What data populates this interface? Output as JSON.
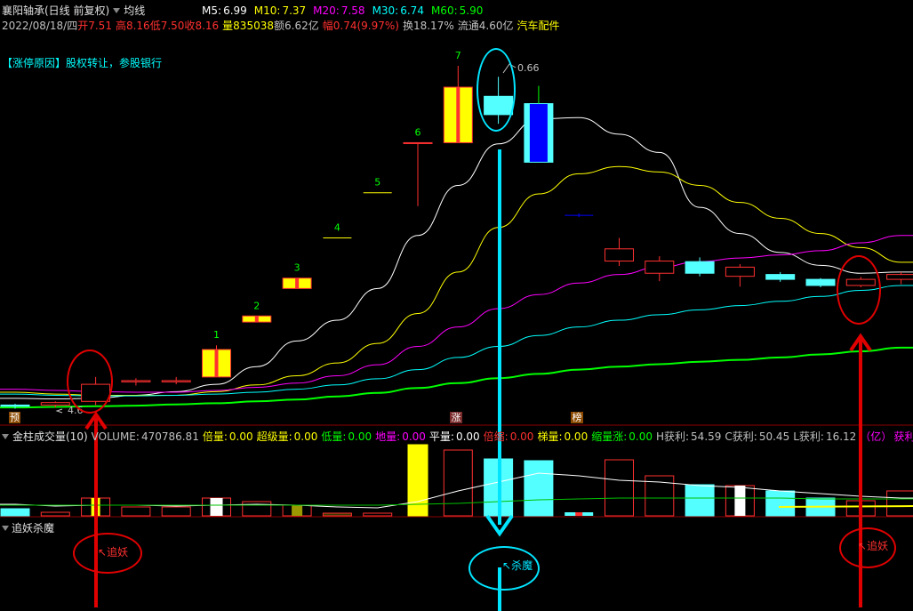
{
  "header": {
    "stock_title": "襄阳轴承(日线 前复权)",
    "indicator_name": "均线",
    "ma": [
      {
        "label": "M5:",
        "value": "6.99",
        "color": "#ffffff"
      },
      {
        "label": "M10:",
        "value": "7.37",
        "color": "#ffff00"
      },
      {
        "label": "M20:",
        "value": "7.58",
        "color": "#ff00ff"
      },
      {
        "label": "M30:",
        "value": "6.74",
        "color": "#00ffff"
      },
      {
        "label": "M60:",
        "value": "5.90",
        "color": "#00ff00"
      }
    ],
    "quote": {
      "date": "2022/08/18/四",
      "open_label": "开",
      "open": "7.51",
      "high_label": "高",
      "high": "8.16",
      "low_label": "低",
      "low": "7.50",
      "close_label": "收",
      "close": "8.16",
      "vol_label": "量",
      "vol": "835038",
      "amount_label": "额",
      "amount": "6.62亿",
      "change_label": "幅",
      "change": "0.74(9.97%)",
      "turnover_label": "换",
      "turnover": "18.17%",
      "float_label": "流通",
      "float": "4.60亿",
      "sector": "汽车配件"
    }
  },
  "reason_text": "【涨停原因】股权转让，参股银行",
  "badges": {
    "yu": "预",
    "zhang": "涨",
    "bang": "榜"
  },
  "price_labels": {
    "low_label": "4.6",
    "high_label": "0.66"
  },
  "count_labels": [
    "1",
    "2",
    "3",
    "4",
    "5",
    "6",
    "7"
  ],
  "volume_panel": {
    "name": "金柱成交量(10)",
    "items": [
      {
        "label": "VOLUME:",
        "value": "470786.81",
        "color": "#c0c0c0"
      },
      {
        "label": "倍量:",
        "value": "0.00",
        "color": "#ffff00"
      },
      {
        "label": "超级量:",
        "value": "0.00",
        "color": "#ffff00"
      },
      {
        "label": "低量:",
        "value": "0.00",
        "color": "#00ff00"
      },
      {
        "label": "地量:",
        "value": "0.00",
        "color": "#ff00ff"
      },
      {
        "label": "平量:",
        "value": "0.00",
        "color": "#ffffff"
      },
      {
        "label": "倍缩:",
        "value": "0.00",
        "color": "#ff3030"
      },
      {
        "label": "梯量:",
        "value": "0.00",
        "color": "#ffff00"
      },
      {
        "label": "缩量涨:",
        "value": "0.00",
        "color": "#00ff00"
      },
      {
        "label": "H获利:",
        "value": "54.59",
        "color": "#c0c0c0"
      },
      {
        "label": "C获利:",
        "value": "50.45",
        "color": "#c0c0c0"
      },
      {
        "label": "L获利:",
        "value": "16.12",
        "color": "#c0c0c0"
      },
      {
        "label": "（亿）",
        "value": "获利筹",
        "color": "#ff00ff"
      }
    ]
  },
  "signal_panel": {
    "name": "追妖杀魔",
    "buy_label": "追妖",
    "kill_label": "杀魔"
  },
  "chart_data": {
    "type": "candlestick",
    "candles": [
      {
        "o": 4.62,
        "h": 4.66,
        "l": 4.58,
        "c": 4.64,
        "color": "cyan"
      },
      {
        "o": 4.64,
        "h": 4.7,
        "l": 4.6,
        "c": 4.68,
        "color": "red"
      },
      {
        "o": 4.7,
        "h": 5.1,
        "l": 4.64,
        "c": 4.98,
        "color": "red"
      },
      {
        "o": 5.02,
        "h": 5.08,
        "l": 4.96,
        "c": 5.04,
        "color": "red"
      },
      {
        "o": 5.02,
        "h": 5.1,
        "l": 4.98,
        "c": 5.04,
        "color": "red"
      },
      {
        "o": 5.1,
        "h": 5.62,
        "l": 5.1,
        "c": 5.55,
        "color": "limit",
        "label": "1"
      },
      {
        "o": 6.0,
        "h": 6.1,
        "l": 6.0,
        "c": 6.1,
        "color": "limit",
        "label": "2"
      },
      {
        "o": 6.55,
        "h": 6.72,
        "l": 6.55,
        "c": 6.72,
        "color": "limit",
        "label": "3"
      },
      {
        "o": 7.38,
        "h": 7.38,
        "l": 7.38,
        "c": 7.38,
        "color": "flat",
        "label": "4"
      },
      {
        "o": 8.12,
        "h": 8.12,
        "l": 8.12,
        "c": 8.12,
        "color": "flat",
        "label": "5"
      },
      {
        "o": 8.94,
        "h": 8.94,
        "l": 7.9,
        "c": 8.94,
        "color": "red",
        "label": "6"
      },
      {
        "o": 8.94,
        "h": 10.2,
        "l": 8.94,
        "c": 9.85,
        "color": "limit",
        "label": "7"
      },
      {
        "o": 9.7,
        "h": 10.02,
        "l": 9.25,
        "c": 9.4,
        "color": "cyan"
      },
      {
        "o": 9.58,
        "h": 9.58,
        "l": 8.62,
        "c": 8.62,
        "color": "blue"
      },
      {
        "o": 7.75,
        "h": 7.78,
        "l": 7.72,
        "c": 7.75,
        "color": "blueflat"
      },
      {
        "o": 7.0,
        "h": 7.38,
        "l": 6.92,
        "c": 7.2,
        "color": "red"
      },
      {
        "o": 6.8,
        "h": 7.08,
        "l": 6.67,
        "c": 7.0,
        "color": "red"
      },
      {
        "o": 6.99,
        "h": 7.06,
        "l": 6.75,
        "c": 6.8,
        "color": "cyan"
      },
      {
        "o": 6.75,
        "h": 6.95,
        "l": 6.58,
        "c": 6.9,
        "color": "red"
      },
      {
        "o": 6.78,
        "h": 6.82,
        "l": 6.66,
        "c": 6.7,
        "color": "cyan"
      },
      {
        "o": 6.7,
        "h": 6.72,
        "l": 6.57,
        "c": 6.6,
        "color": "cyan"
      },
      {
        "o": 6.6,
        "h": 6.74,
        "l": 6.57,
        "c": 6.7,
        "color": "red"
      },
      {
        "o": 6.7,
        "h": 6.82,
        "l": 6.62,
        "c": 6.78,
        "color": "red"
      }
    ],
    "ma_lines": [
      {
        "name": "M5",
        "color": "#ffffff",
        "values": [
          4.75,
          4.74,
          4.75,
          4.8,
          4.86,
          4.98,
          5.27,
          5.69,
          6.03,
          6.55,
          7.42,
          8.24,
          8.92,
          9.33,
          9.35,
          9.08,
          8.78,
          7.88,
          7.45,
          7.14,
          6.93,
          6.8,
          6.82
        ]
      },
      {
        "name": "M10",
        "color": "#ffff00",
        "values": [
          4.85,
          4.82,
          4.8,
          4.8,
          4.8,
          4.86,
          4.97,
          5.12,
          5.33,
          5.65,
          6.14,
          6.82,
          7.55,
          8.1,
          8.43,
          8.55,
          8.46,
          8.24,
          7.96,
          7.7,
          7.45,
          7.22,
          6.98
        ]
      },
      {
        "name": "M20",
        "color": "#ff00ff",
        "values": [
          4.9,
          4.88,
          4.86,
          4.85,
          4.85,
          4.88,
          4.93,
          5.0,
          5.12,
          5.3,
          5.6,
          5.92,
          6.22,
          6.45,
          6.64,
          6.78,
          6.9,
          6.99,
          7.05,
          7.1,
          7.17,
          7.3,
          7.42
        ]
      },
      {
        "name": "M30",
        "color": "#00ffff",
        "values": [
          4.82,
          4.8,
          4.79,
          4.79,
          4.8,
          4.82,
          4.85,
          4.9,
          4.97,
          5.07,
          5.22,
          5.42,
          5.6,
          5.78,
          5.92,
          6.03,
          6.12,
          6.2,
          6.27,
          6.34,
          6.42,
          6.52,
          6.6
        ]
      },
      {
        "name": "M60",
        "color": "#00ff00",
        "values": [
          4.6,
          4.61,
          4.62,
          4.63,
          4.65,
          4.67,
          4.7,
          4.73,
          4.78,
          4.84,
          4.92,
          5.0,
          5.08,
          5.15,
          5.22,
          5.27,
          5.31,
          5.35,
          5.38,
          5.42,
          5.47,
          5.52,
          5.58
        ]
      }
    ],
    "volume": [
      {
        "v": 8,
        "color": "cyan"
      },
      {
        "v": 4,
        "color": "red"
      },
      {
        "v": 20,
        "color": "yellowbar"
      },
      {
        "v": 10,
        "color": "red"
      },
      {
        "v": 10,
        "color": "red"
      },
      {
        "v": 20,
        "color": "white"
      },
      {
        "v": 16,
        "color": "red"
      },
      {
        "v": 12,
        "color": "olive"
      },
      {
        "v": 3,
        "color": "olivebar"
      },
      {
        "v": 3,
        "color": "red"
      },
      {
        "v": 80,
        "color": "yellow"
      },
      {
        "v": 74,
        "color": "red"
      },
      {
        "v": 64,
        "color": "cyan"
      },
      {
        "v": 62,
        "color": "cyan"
      },
      {
        "v": 4,
        "color": "mixed"
      },
      {
        "v": 63,
        "color": "red"
      },
      {
        "v": 45,
        "color": "red"
      },
      {
        "v": 35,
        "color": "cyan"
      },
      {
        "v": 34,
        "color": "redwhite"
      },
      {
        "v": 28,
        "color": "cyan"
      },
      {
        "v": 20,
        "color": "cyan"
      },
      {
        "v": 17,
        "color": "red"
      },
      {
        "v": 28,
        "color": "red"
      }
    ],
    "volume_ma_white": [
      13,
      11,
      12,
      12,
      11,
      12,
      13,
      12,
      10,
      9,
      16,
      28,
      38,
      48,
      45,
      40,
      38,
      34,
      32,
      28,
      25,
      22,
      20
    ],
    "volume_ma_green": [
      12,
      12,
      12,
      12,
      12,
      12,
      12,
      12,
      12,
      12,
      13,
      14,
      16,
      18,
      19,
      20,
      20,
      20,
      20,
      20,
      19,
      19,
      19
    ]
  }
}
